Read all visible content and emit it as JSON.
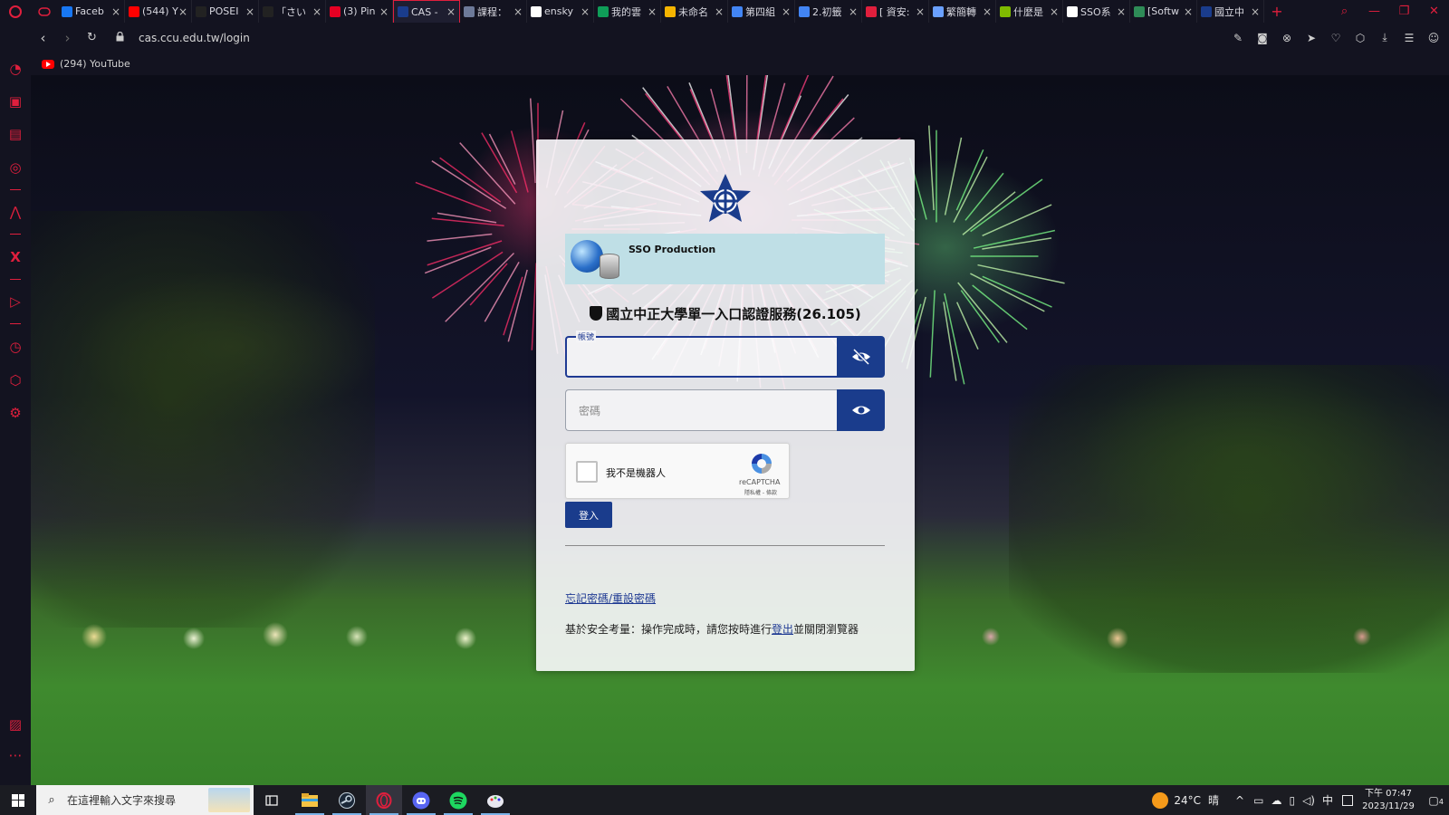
{
  "browser": {
    "tabs": [
      {
        "title": "Faceb",
        "icon": "facebook-icon",
        "color": "#1877f2"
      },
      {
        "title": "(544) Y",
        "icon": "youtube-icon",
        "color": "#ff0000"
      },
      {
        "title": "POSEI",
        "icon": "pinterest-icon",
        "color": "#222222"
      },
      {
        "title": "「さい",
        "icon": "pinterest-icon",
        "color": "#222222"
      },
      {
        "title": "(3) Pin",
        "icon": "pinterest-icon",
        "color": "#e60023"
      },
      {
        "title": "CAS -",
        "icon": "ccu-emblem-icon",
        "color": "#1a3c8c"
      },
      {
        "title": "課程：",
        "icon": "course-icon",
        "color": "#6d7a99"
      },
      {
        "title": "ensky",
        "icon": "google-icon",
        "color": "#ffffff"
      },
      {
        "title": "我的雲",
        "icon": "drive-icon",
        "color": "#0f9d58"
      },
      {
        "title": "未命名",
        "icon": "slides-icon",
        "color": "#f4b400"
      },
      {
        "title": "第四組",
        "icon": "docs-icon",
        "color": "#4285f4"
      },
      {
        "title": "2.初籤",
        "icon": "docs-icon",
        "color": "#4285f4"
      },
      {
        "title": "[ 資安:",
        "icon": "red-swirl-icon",
        "color": "#e01f3d"
      },
      {
        "title": "繁簡轉",
        "icon": "sparkle-icon",
        "color": "#6aa0ff"
      },
      {
        "title": "什麼是",
        "icon": "microsoft-icon",
        "color": "#7fba00"
      },
      {
        "title": "SSO系",
        "icon": "google-icon",
        "color": "#ffffff"
      },
      {
        "title": "[Softw",
        "icon": "devi-icon",
        "color": "#2e8b57"
      },
      {
        "title": "國立中",
        "icon": "ccu-emblem-icon",
        "color": "#1a3c8c"
      }
    ],
    "active_tab_index": 5,
    "url": "cas.ccu.edu.tw/login",
    "bookmark": {
      "label": "(294) YouTube",
      "icon": "youtube-icon"
    },
    "accent_color": "#e01f3d"
  },
  "login": {
    "banner_text": "SSO Production",
    "title": "國立中正大學單一入口認證服務(26.105)",
    "account_label": "帳號",
    "account_value": "",
    "password_placeholder": "密碼",
    "captcha_text": "我不是機器人",
    "captcha_brand": "reCAPTCHA",
    "captcha_links": "隱私權 - 條款",
    "login_button": "登入",
    "forgot_link": "忘記密碼/重設密碼",
    "notice_before": "基於安全考量：操作完成時，請您按時進行",
    "notice_link": "登出",
    "notice_after": "並關閉瀏覽器",
    "primary_color": "#1a3c8c"
  },
  "taskbar": {
    "search_placeholder": "在這裡輸入文字來搜尋",
    "weather": "24°C",
    "weather_desc": "晴",
    "ime": "中",
    "time_line1": "下午 07:47",
    "time_line2": "2023/11/29",
    "notification_count": "4"
  }
}
